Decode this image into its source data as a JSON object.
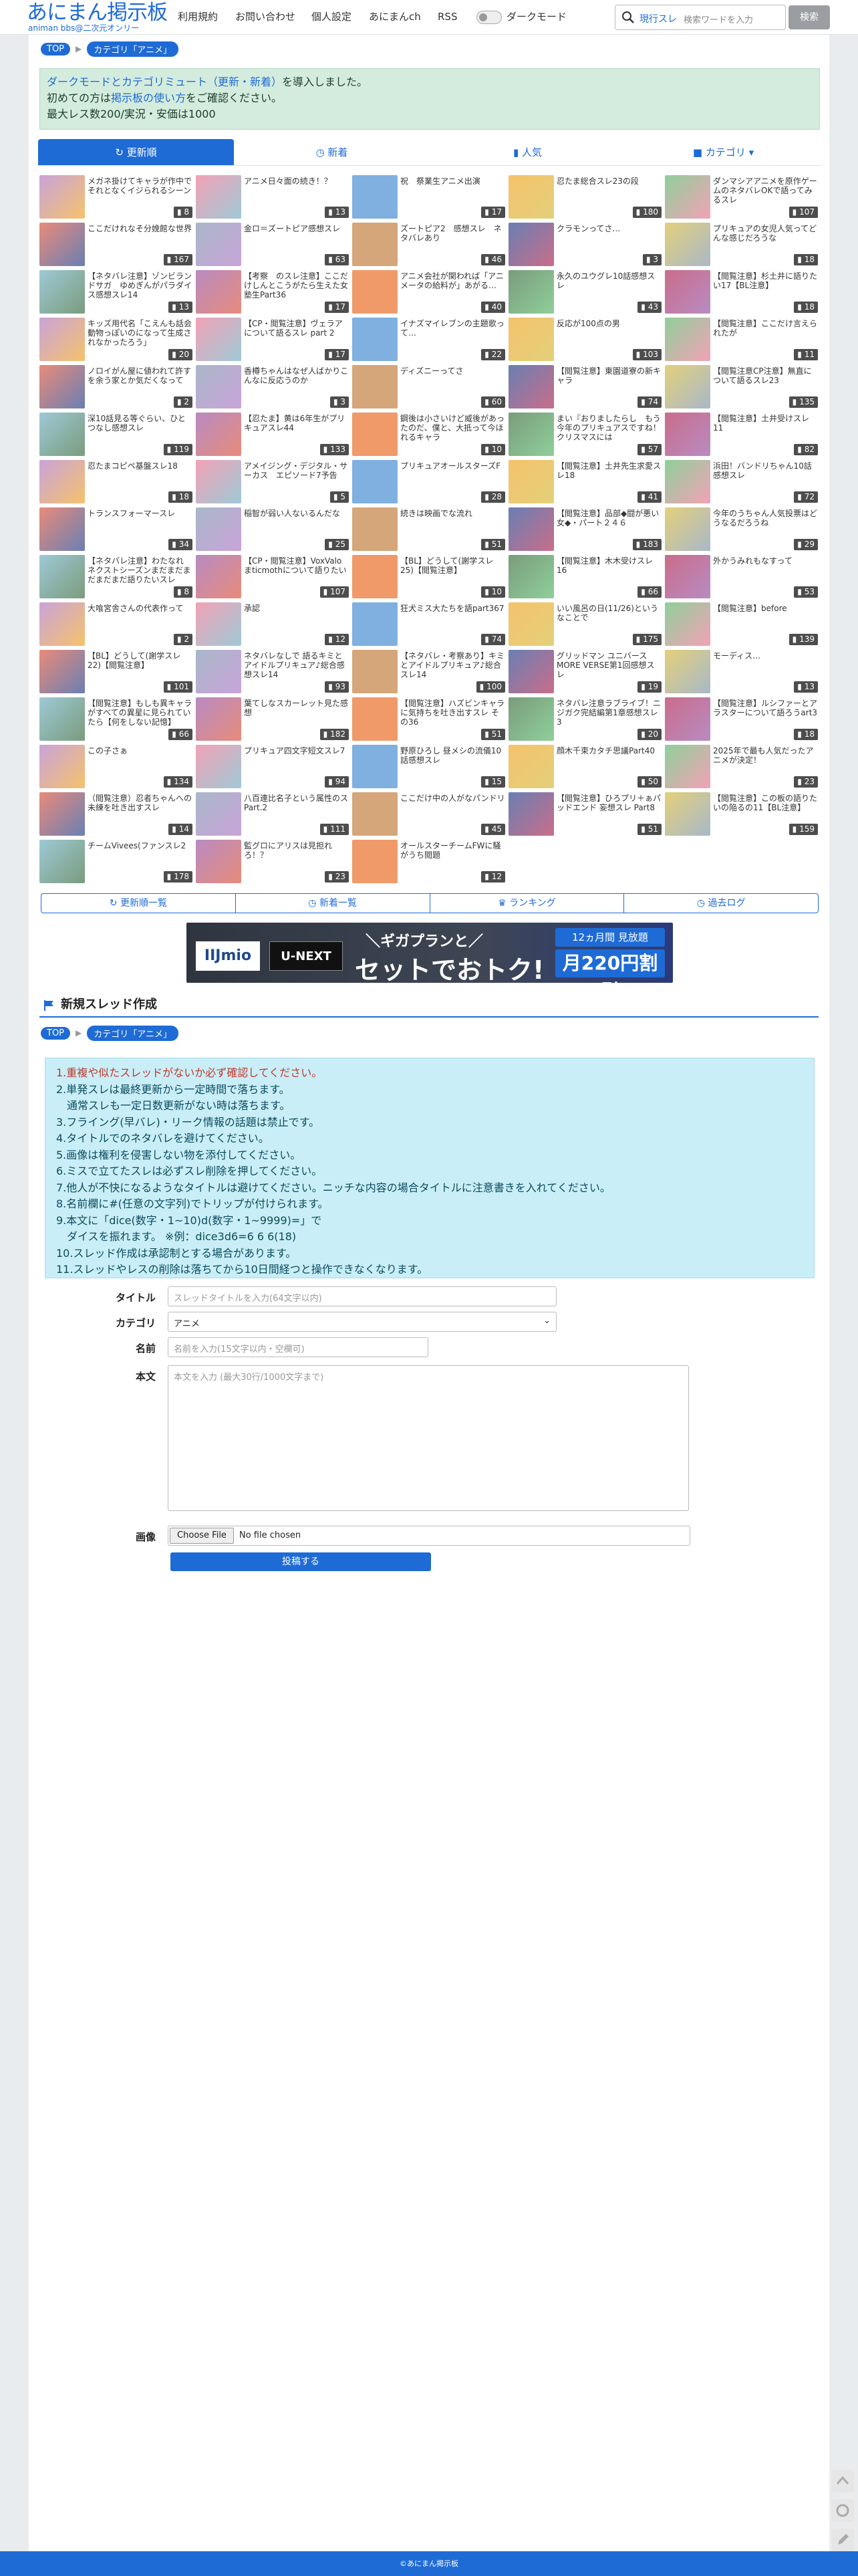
{
  "header": {
    "logo_main": "あにまん掲示板",
    "logo_sub": "animan bbs@二次元オンリー",
    "nav": [
      "利用規約",
      "お問い合わせ",
      "個人設定",
      "あにまんch",
      "RSS"
    ],
    "dark_mode_label": "ダークモード",
    "search_mode": "現行スレ",
    "search_placeholder": "検索ワードを入力",
    "search_button": "検索"
  },
  "breadcrumb": {
    "top": "TOP",
    "category": "カテゴリ「アニメ」"
  },
  "notice": {
    "line1_link": "ダークモードとカテゴリミュート（更新・新着）",
    "line1_rest": "を導入しました。",
    "line2_pre": "初めての方は",
    "line2_link": "掲示板の使い方",
    "line2_post": "をご確認ください。",
    "line3": "最大レス数200/実況・安価は1000"
  },
  "tabs": [
    "更新順",
    "新着",
    "人気",
    "カテゴリ"
  ],
  "threads": [
    [
      "メガネ掛けてキャラが作中でそれとなくイジられるシーン",
      "8"
    ],
    [
      "アニメ日々面の続き！？",
      "13"
    ],
    [
      "祝　祭業生アニメ出演",
      "17"
    ],
    [
      "忍たま総合スレ23の段",
      "180"
    ],
    [
      "ダンマシアアニメを原作ゲームのネタバレOKで語ってみるスレ",
      "107"
    ],
    [
      "ここだけれなそ分娩館な世界",
      "167"
    ],
    [
      "金ロ＝ズートピア感想スレ",
      "63"
    ],
    [
      "ズートピア2　感想スレ　ネタバレあり",
      "46"
    ],
    [
      "クラモンってさ…",
      "3"
    ],
    [
      "プリキュアの女児人気ってどんな感じだろうな",
      "18"
    ],
    [
      "【ネタバレ注意】ゾンビランドサガ　ゆめぎんがパラダイス感想スレ14",
      "13"
    ],
    [
      "【考察　のスレ注意】ここだけしんとこうがたら生えた女塾生Part36",
      "17"
    ],
    [
      "アニメ会社が関われば「アニメータの給料が」あがる…",
      "40"
    ],
    [
      "永久のユウグレ10話感想スレ",
      "43"
    ],
    [
      "【閲覧注意】杉土井に語りたい17【BL注意】",
      "18"
    ],
    [
      "キッズ用代名「こえんも話会動物っぽいのになって生成されなかったろう」",
      "20"
    ],
    [
      "【CP・閲覧注意】ヴェラアについて語るスレ part 2",
      "17"
    ],
    [
      "イナズマイレブンの主題歌って…",
      "22"
    ],
    [
      "反応が100点の男",
      "103"
    ],
    [
      "【閲覧注意】ここだけ言えられたが",
      "11"
    ],
    [
      "ノロイがん屋に値われて許すを余う家とか気だくなって",
      "2"
    ],
    [
      "香樽ちゃんはなぜ人ばかりこんなに反応うのか",
      "3"
    ],
    [
      "ディズニーってさ",
      "60"
    ],
    [
      "【閲覧注意】東園道寮の新キャラ",
      "74"
    ],
    [
      "【閲覧注意CP注意】無直について語るスレ23",
      "135"
    ],
    [
      "深10話見る等ぐらい、ひとつなし感想スレ",
      "119"
    ],
    [
      "【忍たま】黄は6年生がプリキュアスレ44",
      "133"
    ],
    [
      "鋼後は小さいけど威後があったのだ、僕と、大抵って今ほれるキャラ",
      "10"
    ],
    [
      "まい『おりましたらし　もう今年のプリキュアスですね！クリスマスには",
      "57"
    ],
    [
      "【閲覧注意】土井受けスレ11",
      "82"
    ],
    [
      "忍たまコピペ基盤スレ18",
      "18"
    ],
    [
      "アメイジング・デジタル・サーカス　エピソード7予告",
      "5"
    ],
    [
      "プリキュアオールスターズF",
      "28"
    ],
    [
      "【閲覧注意】土井先生求愛スレ18",
      "41"
    ],
    [
      "浜田！バンドリちゃん10話感想スレ",
      "72"
    ],
    [
      "トランスフォーマースレ",
      "34"
    ],
    [
      "稲智が弱い人ないるんだな",
      "25"
    ],
    [
      "続きは映画でな流れ",
      "51"
    ],
    [
      "【閲覧注意】品部◆闘が悪い女◆・パート２４６",
      "183"
    ],
    [
      "今年のうちゃん人気投票はどうなるだろうね",
      "29"
    ],
    [
      "【ネタバレ注意】わたなれ ネクストシーズンまだまだまだまだまだ語りたいスレ",
      "8"
    ],
    [
      "【CP・閲覧注意】VoxValoまticmothについて語りたい",
      "107"
    ],
    [
      "【BL】どうして(謝学スレ25)【閲覧注意】",
      "10"
    ],
    [
      "【閲覧注意】木木受けスレ16",
      "66"
    ],
    [
      "外かうみれもなすって",
      "53"
    ],
    [
      "大喰宮舎さんの代表作って",
      "2"
    ],
    [
      "承認",
      "12"
    ],
    [
      "狂犬ミス大たちを語part367",
      "74"
    ],
    [
      "いい風呂の日(11/26)というなことで",
      "175"
    ],
    [
      "【閲覧注意】before",
      "139"
    ],
    [
      "【BL】どうして(謝学スレ22)【閲覧注意】",
      "101"
    ],
    [
      "ネタバレなしで 語るキミとアイドルプリキュア♪総合感想スレ14",
      "93"
    ],
    [
      "【ネタバレ・考察あり】キミとアイドルプリキュア♪総合スレ14",
      "100"
    ],
    [
      "グリッドマン ユニバース MORE VERSE第1回感想スレ",
      "19"
    ],
    [
      "モーディス…",
      "13"
    ],
    [
      "【閲覧注意】もしも異キャラがすべての異星に見られていたら【何をしない記憶】",
      "66"
    ],
    [
      "葉てしなスカーレット見た感想",
      "182"
    ],
    [
      "【閲覧注意】ハズビンキャラに気持ちを吐き出すスレ その36",
      "51"
    ],
    [
      "ネタバレ注意ラブライブ！ニジガク完結編第1章感想スレ3",
      "20"
    ],
    [
      "【閲覧注意】ルシファーとアラスターについて語ろうart3",
      "18"
    ],
    [
      "この子さぁ",
      "134"
    ],
    [
      "プリキュア四文字短文スレ7",
      "94"
    ],
    [
      "野原ひろし 昼メシの流儀10話感想スレ",
      "15"
    ],
    [
      "顔木千束カタチ思議Part40",
      "50"
    ],
    [
      "2025年で最も人気だったアニメが決定！",
      "23"
    ],
    [
      "（閲覧注意）忍者ちゃんへの未練を吐き出すスレ",
      "14"
    ],
    [
      "八百連比名子という属性のスPart.2",
      "111"
    ],
    [
      "ここだけ中の人がなパンドリ",
      "45"
    ],
    [
      "【閲覧注意】ひろプリ＋ぁパッドエンド 妄想スレ Part8",
      "51"
    ],
    [
      "【閲覧注意】この板の語りたいの陥るの11【BL注意】",
      "159"
    ],
    [
      "チームVivees(ファンスレ2",
      "178"
    ],
    [
      "監グロにアリスは見担れろ！？",
      "23"
    ],
    [
      "オールスターチームFWに騒がうち閲題",
      "12"
    ]
  ],
  "bottom_nav": [
    "更新順一覧",
    "新着一覧",
    "ランキング",
    "過去ログ"
  ],
  "ad": {
    "brand1": "IIJmio",
    "brand2": "U-NEXT",
    "line1": "＼ギガプランと／",
    "line2": "セットでおトク!",
    "promo1": "12ヵ月間 見放題",
    "promo2": "月220円割引"
  },
  "new_thread": {
    "heading": "新規スレッド作成",
    "rules": [
      "1.重複や似たスレッドがないか必ず確認してください。",
      "2.単発スレは最終更新から一定時間で落ちます。",
      "　通常スレも一定日数更新がない時は落ちます。",
      "3.フライング(早バレ)・リーク情報の話題は禁止です。",
      "4.タイトルでのネタバレを避けてください。",
      "5.画像は権利を侵害しない物を添付してください。",
      "6.ミスで立てたスレは必ずスレ削除を押してください。",
      "7.他人が不快になるようなタイトルは避けてください。ニッチな内容の場合タイトルに注意書きを入れてください。",
      "8.名前欄に#(任意の文字列)でトリップが付けられます。",
      "9.本文に「dice(数字・1~10)d(数字・1~9999)=」で",
      "　ダイスを振れます。 ※例：dice3d6=6 6 6(18)",
      "10.スレッド作成は承認制とする場合があります。",
      "11.スレッドやレスの削除は落ちてから10日間経つと操作できなくなります。"
    ],
    "title_label": "タイトル",
    "title_placeholder": "スレッドタイトルを入力(64文字以内)",
    "category_label": "カテゴリ",
    "category_value": "アニメ",
    "name_label": "名前",
    "name_placeholder": "名前を入力(15文字以内・空欄可)",
    "body_label": "本文",
    "body_placeholder": "本文を入力 (最大30行/1000文字まで)",
    "image_label": "画像",
    "file_button": "Choose File",
    "file_status": "No file chosen",
    "submit": "投稿する"
  },
  "footer": "©あにまん掲示板",
  "colors": {
    "accent": "#1e6bd6",
    "notice_bg": "#d4ecdd",
    "rules_bg": "#c9eef7",
    "warn": "#c0392b"
  }
}
